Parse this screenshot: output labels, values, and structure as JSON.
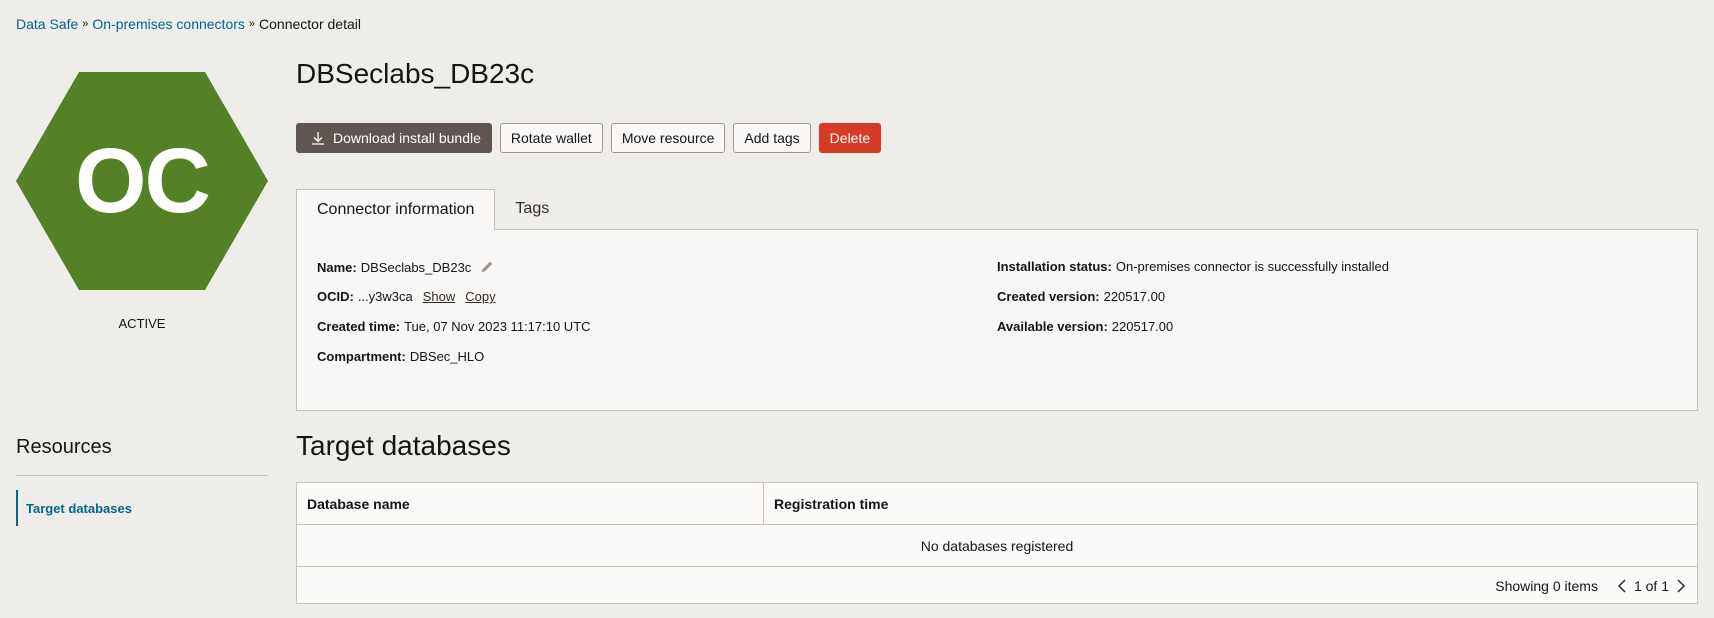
{
  "breadcrumb": {
    "items": [
      {
        "label": "Data Safe"
      },
      {
        "label": "On-premises connectors"
      }
    ],
    "current": "Connector detail",
    "separator": "»"
  },
  "resource_icon": {
    "initials": "OC",
    "color": "#548126",
    "status": "ACTIVE"
  },
  "page": {
    "title": "DBSeclabs_DB23c"
  },
  "actions": {
    "download": "Download install bundle",
    "rotate": "Rotate wallet",
    "move": "Move resource",
    "add_tags": "Add tags",
    "delete": "Delete"
  },
  "tabs": [
    {
      "label": "Connector information",
      "active": true
    },
    {
      "label": "Tags",
      "active": false
    }
  ],
  "info": {
    "name_label": "Name:",
    "name_value": "DBSeclabs_DB23c",
    "ocid_label": "OCID:",
    "ocid_value": "...y3w3ca",
    "ocid_show": "Show",
    "ocid_copy": "Copy",
    "created_time_label": "Created time:",
    "created_time_value": "Tue, 07 Nov 2023 11:17:10 UTC",
    "compartment_label": "Compartment:",
    "compartment_value": "DBSec_HLO",
    "install_status_label": "Installation status:",
    "install_status_value": "On-premises connector is successfully installed",
    "created_version_label": "Created version:",
    "created_version_value": "220517.00",
    "available_version_label": "Available version:",
    "available_version_value": "220517.00"
  },
  "resources": {
    "title": "Resources",
    "items": [
      {
        "label": "Target databases",
        "active": true
      }
    ]
  },
  "target_databases": {
    "title": "Target databases",
    "columns": [
      "Database name",
      "Registration time"
    ],
    "empty_message": "No databases registered",
    "footer_showing": "Showing 0 items",
    "pagination": "1 of 1"
  }
}
